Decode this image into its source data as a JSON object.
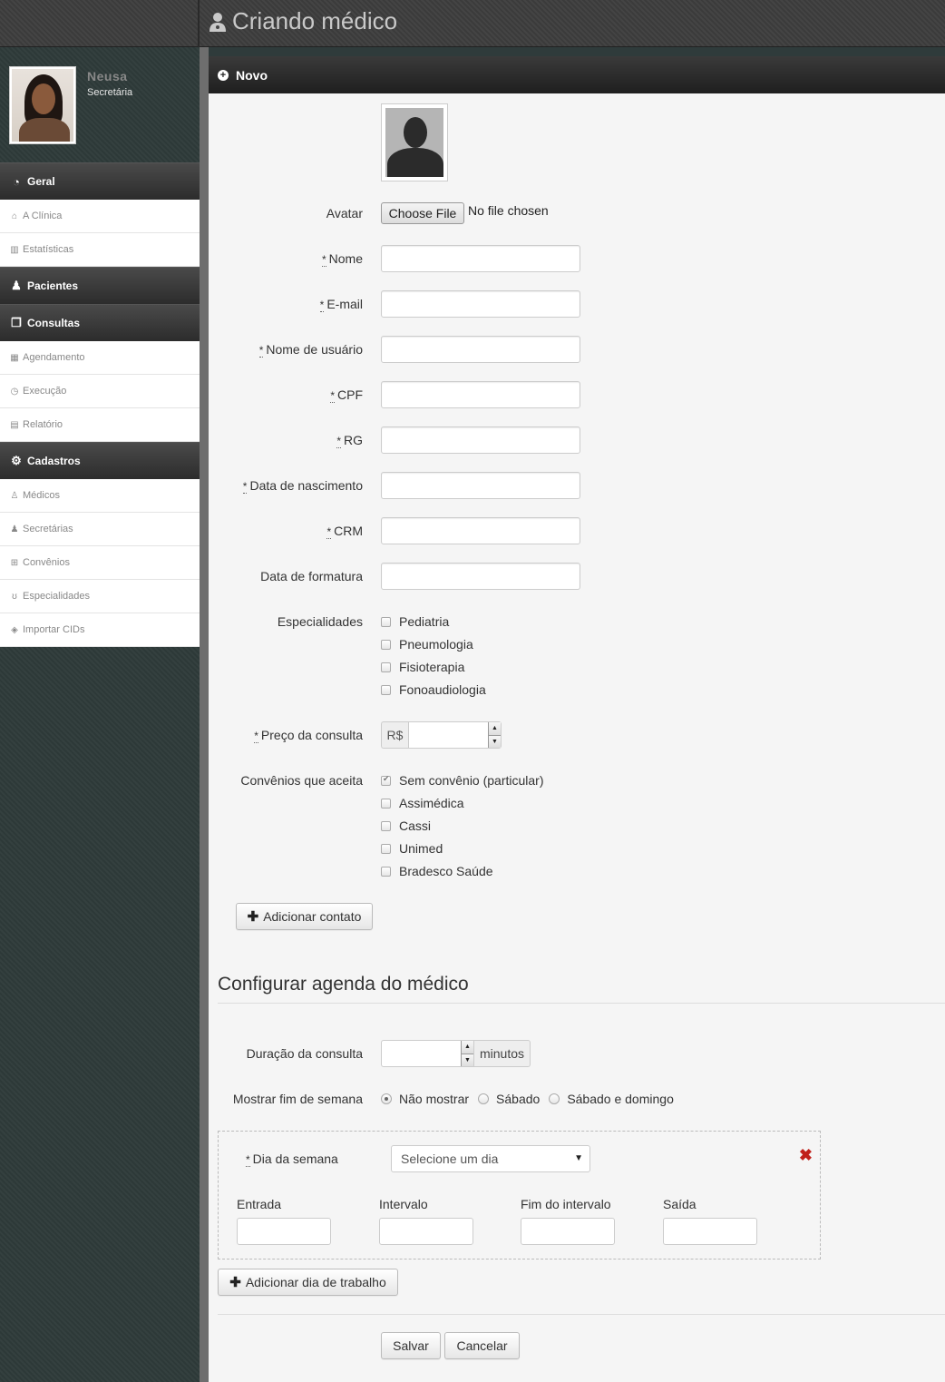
{
  "header": {
    "title": "Criando médico",
    "title_icon": "user-md-icon"
  },
  "user": {
    "name": "Neusa",
    "role": "Secretária"
  },
  "sidebar": {
    "sections": [
      {
        "label": "Geral",
        "icon": "dashboard-icon",
        "items": [
          {
            "label": "A Clínica",
            "icon": "home-icon"
          },
          {
            "label": "Estatísticas",
            "icon": "bar-chart-icon"
          }
        ]
      },
      {
        "label": "Pacientes",
        "icon": "group-icon",
        "items": []
      },
      {
        "label": "Consultas",
        "icon": "copy-icon",
        "items": [
          {
            "label": "Agendamento",
            "icon": "calendar-icon"
          },
          {
            "label": "Execução",
            "icon": "clock-icon"
          },
          {
            "label": "Relatório",
            "icon": "file-icon"
          }
        ]
      },
      {
        "label": "Cadastros",
        "icon": "gear-icon",
        "items": [
          {
            "label": "Médicos",
            "icon": "user-md-icon"
          },
          {
            "label": "Secretárias",
            "icon": "user-icon"
          },
          {
            "label": "Convênios",
            "icon": "medkit-icon"
          },
          {
            "label": "Especialidades",
            "icon": "stethoscope-icon"
          },
          {
            "label": "Importar CIDs",
            "icon": "tags-icon"
          }
        ]
      }
    ]
  },
  "panel": {
    "title": "Novo"
  },
  "form": {
    "avatar_label": "Avatar",
    "file_button": "Choose File",
    "file_status": "No file chosen",
    "required_mark": "*",
    "nome_label": "Nome",
    "email_label": "E-mail",
    "usuario_label": "Nome de usuário",
    "cpf_label": "CPF",
    "rg_label": "RG",
    "nascimento_label": "Data de nascimento",
    "crm_label": "CRM",
    "formatura_label": "Data de formatura",
    "especialidades_label": "Especialidades",
    "especialidades": [
      "Pediatria",
      "Pneumologia",
      "Fisioterapia",
      "Fonoaudiologia"
    ],
    "preco_label": "Preço da consulta",
    "currency_prefix": "R$",
    "convenios_label": "Convênios que aceita",
    "convenios": [
      {
        "label": "Sem convênio (particular)",
        "checked": true
      },
      {
        "label": "Assimédica",
        "checked": false
      },
      {
        "label": "Cassi",
        "checked": false
      },
      {
        "label": "Unimed",
        "checked": false
      },
      {
        "label": "Bradesco Saúde",
        "checked": false
      }
    ],
    "add_contact_button": "Adicionar contato"
  },
  "agenda": {
    "section_title": "Configurar agenda do médico",
    "duracao_label": "Duração da consulta",
    "duracao_suffix": "minutos",
    "fim_semana_label": "Mostrar fim de semana",
    "fim_semana_options": [
      {
        "label": "Não mostrar",
        "checked": true
      },
      {
        "label": "Sábado",
        "checked": false
      },
      {
        "label": "Sábado e domingo",
        "checked": false
      }
    ],
    "dia_label": "Dia da semana",
    "dia_placeholder": "Selecione um dia",
    "entrada_label": "Entrada",
    "intervalo_label": "Intervalo",
    "fim_intervalo_label": "Fim do intervalo",
    "saida_label": "Saída",
    "add_day_button": "Adicionar dia de trabalho"
  },
  "actions": {
    "save": "Salvar",
    "cancel": "Cancelar"
  },
  "colors": {
    "remove": "#c0201a",
    "panel_header": "#1f1f1f"
  }
}
